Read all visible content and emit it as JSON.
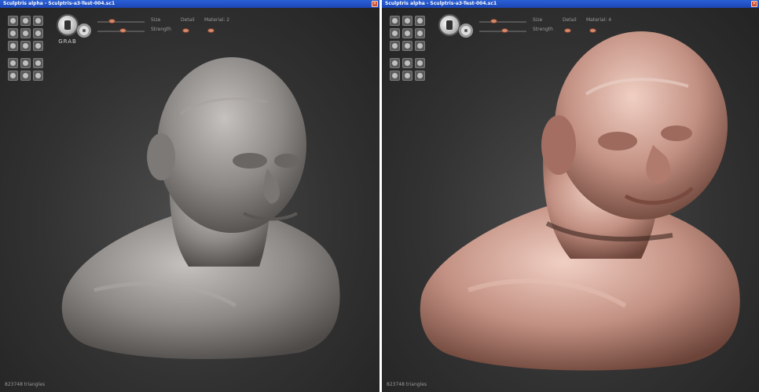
{
  "windows": [
    {
      "id": "left",
      "title": "Sculptris alpha - Sculptris-a3-Test-004.sc1",
      "tool_label": "GRAB",
      "sliders": {
        "size_label": "Size",
        "strength_label": "Strength",
        "detail_label": "Detail",
        "material_label": "Material: 2",
        "size_value": 0.3,
        "strength_value": 0.5,
        "detail_value": 0.2
      },
      "status": "823748 triangles",
      "material_color": "#8e8a88"
    },
    {
      "id": "right",
      "title": "Sculptris alpha - Sculptris-a3-Test-004.sc1",
      "tool_label": "",
      "sliders": {
        "size_label": "Size",
        "strength_label": "Strength",
        "detail_label": "Detail",
        "material_label": "Material: 4",
        "size_value": 0.3,
        "strength_value": 0.5,
        "detail_value": 0.2
      },
      "status": "823748 triangles",
      "material_color": "#c99a8a"
    }
  ],
  "icons": {
    "tools": [
      "draw-icon",
      "rotate-icon",
      "scale-icon",
      "inflate-icon",
      "pinch-icon",
      "flatten-icon",
      "smooth-icon",
      "crease-icon",
      "grab-icon",
      "symmetry-icon",
      "wireframe-icon",
      "reduce-icon",
      "mask-icon",
      "undo-icon",
      "redo-icon"
    ]
  }
}
